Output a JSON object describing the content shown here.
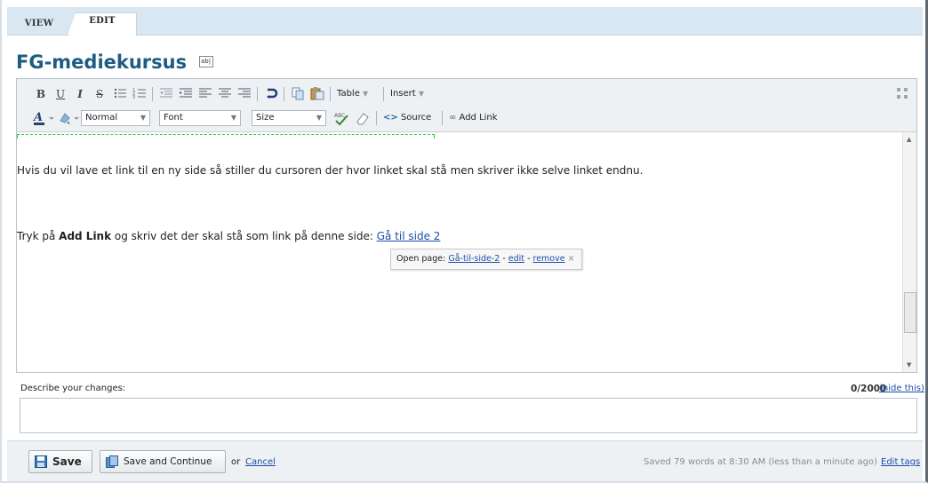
{
  "tabs": [
    {
      "label": "VIEW",
      "active": false
    },
    {
      "label": "EDIT",
      "active": true
    }
  ],
  "page_title": "FG-mediekursus",
  "title_edit_icon_text": "ab|",
  "toolbar": {
    "bold": "B",
    "underline": "U",
    "italic": "I",
    "strike": "S",
    "table_label": "Table",
    "insert_label": "Insert",
    "format_value": "Normal",
    "font_value": "Font",
    "size_value": "Size",
    "source_label": "Source",
    "add_link_label": "Add Link",
    "icons": [
      "bulleted-list-icon",
      "numbered-list-icon",
      "outdent-icon",
      "indent-icon",
      "align-left-icon",
      "align-center-icon",
      "align-right-icon",
      "undo-icon",
      "copy-icon",
      "paste-icon",
      "font-color-icon",
      "highlight-icon",
      "spellcheck-icon",
      "eraser-icon",
      "source-icon",
      "link-icon",
      "maximize-icon"
    ]
  },
  "content": {
    "para1": "Hvis du vil lave et link til en ny side så stiller du cursoren der hvor linket skal stå men skriver ikke selve linket endnu.",
    "para2_prefix": "Tryk på ",
    "para2_bold": "Add Link",
    "para2_middle": " og skriv det der skal stå som link på denne side: ",
    "para2_link": "Gå til side 2"
  },
  "popup": {
    "prefix": "Open page: ",
    "page_link": "Gå-til-side-2",
    "sep1": " - ",
    "edit_link": "edit",
    "sep2": " - ",
    "remove_link": "remove",
    "close": "×"
  },
  "describe": {
    "label": "Describe your changes:",
    "count": "0/2000",
    "hide": "(hide this)",
    "value": ""
  },
  "bottom": {
    "save": "Save",
    "save_continue": "Save and Continue",
    "or": "or",
    "cancel": "Cancel",
    "saved_status": "Saved 79 words at 8:30 AM (less than a minute ago)",
    "edit_tags": "Edit tags"
  }
}
